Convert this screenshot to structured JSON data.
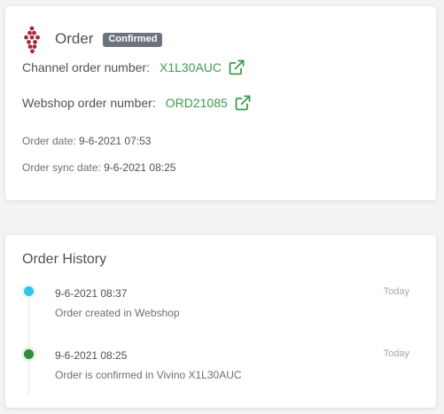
{
  "order": {
    "title": "Order",
    "status": "Confirmed",
    "channel_label": "Channel order number:",
    "channel_number": "X1L30AUC",
    "webshop_label": "Webshop order number:",
    "webshop_number": "ORD21085",
    "date_label": "Order date:",
    "date_value": "9-6-2021 07:53",
    "sync_label": "Order sync date:",
    "sync_value": "9-6-2021 08:25",
    "logo_icon": "grape-cluster-icon",
    "link_icon": "external-link-icon",
    "colors": {
      "logo": "#a52a3a",
      "link": "#3c9a4f",
      "badge": "#6c737a"
    }
  },
  "history": {
    "title": "Order History",
    "events": [
      {
        "time": "9-6-2021 08:37",
        "description": "Order created in Webshop",
        "relative": "Today",
        "dot_color": "#2fc6e6"
      },
      {
        "time": "9-6-2021 08:25",
        "description": "Order is confirmed in Vivino X1L30AUC",
        "relative": "Today",
        "dot_color": "#2f8b3d"
      }
    ]
  }
}
